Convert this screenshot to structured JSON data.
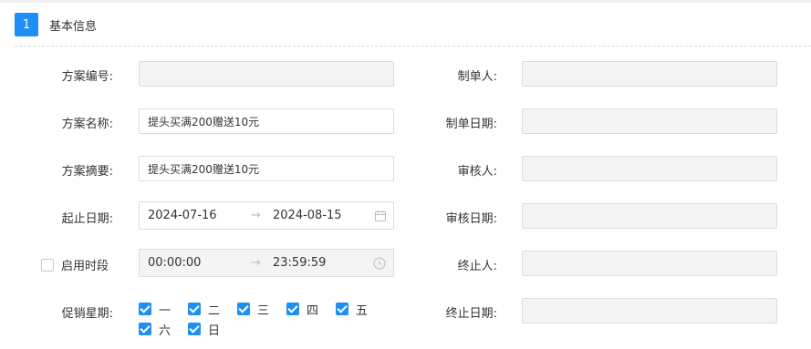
{
  "section": {
    "number": "1",
    "title": "基本信息"
  },
  "form": {
    "scheme_no": {
      "label": "方案编号:",
      "value": ""
    },
    "scheme_name": {
      "label": "方案名称:",
      "value": "提头买满200赠送10元"
    },
    "scheme_summary": {
      "label": "方案摘要:",
      "value": "提头买满200赠送10元"
    },
    "date_range": {
      "label": "起止日期:",
      "start": "2024-07-16",
      "separator": "→",
      "end": "2024-08-15",
      "icon": "calendar-icon"
    },
    "time_period": {
      "label": "启用时段",
      "checked": false,
      "start": "00:00:00",
      "separator": "→",
      "end": "23:59:59",
      "icon": "clock-icon"
    },
    "promo_weekdays": {
      "label": "促销星期:",
      "days": [
        {
          "label": "一",
          "checked": true
        },
        {
          "label": "二",
          "checked": true
        },
        {
          "label": "三",
          "checked": true
        },
        {
          "label": "四",
          "checked": true
        },
        {
          "label": "五",
          "checked": true
        },
        {
          "label": "六",
          "checked": true
        },
        {
          "label": "日",
          "checked": true
        }
      ]
    },
    "creator": {
      "label": "制单人:",
      "value": ""
    },
    "create_date": {
      "label": "制单日期:",
      "value": ""
    },
    "reviewer": {
      "label": "审核人:",
      "value": ""
    },
    "review_date": {
      "label": "审核日期:",
      "value": ""
    },
    "terminator": {
      "label": "终止人:",
      "value": ""
    },
    "terminate_date": {
      "label": "终止日期:",
      "value": ""
    }
  },
  "colors": {
    "accent": "#1f8ff5",
    "disabled_bg": "#f4f4f4",
    "border": "#dcdcdc"
  }
}
